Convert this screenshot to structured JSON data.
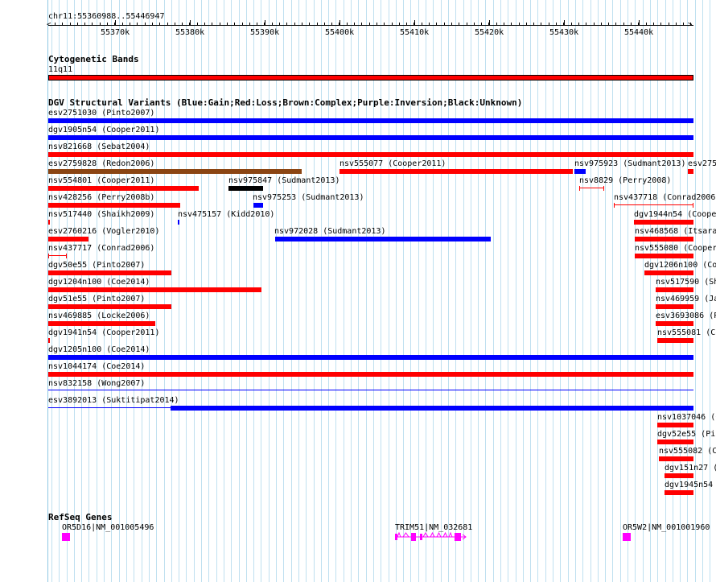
{
  "ruler": {
    "position_label": "chr11:55360988..55446947",
    "tick_labels": [
      "55370k",
      "55380k",
      "55390k",
      "55400k",
      "55410k",
      "55420k",
      "55430k",
      "55440k"
    ]
  },
  "cytoband": {
    "track_title": "Cytogenetic Bands",
    "band_label": "11q11",
    "band_color": "#ff0000"
  },
  "dgv": {
    "track_title": "DGV Structural Variants (Blue:Gain;Red:Loss;Brown:Complex;Purple:Inversion;Black:Unknown)",
    "colors": {
      "gain": "#0000ff",
      "loss": "#ff0000",
      "complex": "#8b4513",
      "inversion": "#800080",
      "unknown": "#000000"
    },
    "variants": [
      {
        "label": "esv2751030 (Pinto2007)",
        "type": "gain"
      },
      {
        "label": "dgv1905n54 (Cooper2011)",
        "type": "gain"
      },
      {
        "label": "nsv821668 (Sebat2004)",
        "type": "loss"
      },
      {
        "label": "esv2759828 (Redon2006)",
        "type": "complex"
      },
      {
        "label": "nsv555077 (Cooper2011)",
        "type": "loss"
      },
      {
        "label": "nsv975923 (Sudmant2013)",
        "type": "gain"
      },
      {
        "label": "esv275",
        "type": "loss"
      },
      {
        "label": "nsv554801 (Cooper2011)",
        "type": "loss"
      },
      {
        "label": "nsv975847 (Sudmant2013)",
        "type": "unknown"
      },
      {
        "label": "nsv8829 (Perry2008)",
        "type": "loss"
      },
      {
        "label": "nsv428256 (Perry2008b)",
        "type": "loss"
      },
      {
        "label": "nsv975253 (Sudmant2013)",
        "type": "gain"
      },
      {
        "label": "nsv437718 (Conrad2006",
        "type": "loss"
      },
      {
        "label": "nsv517440 (Shaikh2009)",
        "type": "loss"
      },
      {
        "label": "nsv475157 (Kidd2010)",
        "type": "gain"
      },
      {
        "label": "dgv1944n54 (Coope",
        "type": "loss"
      },
      {
        "label": "esv2760216 (Vogler2010)",
        "type": "loss"
      },
      {
        "label": "nsv972028 (Sudmant2013)",
        "type": "gain"
      },
      {
        "label": "nsv468568 (Itsara",
        "type": "loss"
      },
      {
        "label": "nsv437717 (Conrad2006)",
        "type": "loss"
      },
      {
        "label": "nsv555080 (Cooper",
        "type": "loss"
      },
      {
        "label": "dgv50e55 (Pinto2007)",
        "type": "loss"
      },
      {
        "label": "dgv1206n100 (Co",
        "type": "loss"
      },
      {
        "label": "dgv1204n100 (Coe2014)",
        "type": "loss"
      },
      {
        "label": "nsv517590 (Sh",
        "type": "loss"
      },
      {
        "label": "dgv51e55 (Pinto2007)",
        "type": "loss"
      },
      {
        "label": "nsv469959 (Ja",
        "type": "loss"
      },
      {
        "label": "nsv469885 (Locke2006)",
        "type": "loss"
      },
      {
        "label": "esv3693086 (P",
        "type": "loss"
      },
      {
        "label": "dgv1941n54 (Cooper2011)",
        "type": "loss"
      },
      {
        "label": "nsv555081 (Co",
        "type": "loss"
      },
      {
        "label": "dgv1205n100 (Coe2014)",
        "type": "gain"
      },
      {
        "label": "nsv1044174 (Coe2014)",
        "type": "loss"
      },
      {
        "label": "nsv832158 (Wong2007)",
        "type": "gain"
      },
      {
        "label": "esv3892013 (Suktitipat2014)",
        "type": "gain"
      },
      {
        "label": "nsv1037046 (C",
        "type": "loss"
      },
      {
        "label": "dgv52e55 (Pin",
        "type": "loss"
      },
      {
        "label": "nsv555082 (Co",
        "type": "loss"
      },
      {
        "label": "dgv151n27 (Co",
        "type": "loss"
      },
      {
        "label": "dgv1945n54",
        "type": "loss"
      }
    ]
  },
  "refseq": {
    "track_title": "RefSeq Genes",
    "gene_color": "#ff00ff",
    "genes": [
      {
        "label": "OR5D16|NM_001005496"
      },
      {
        "label": "TRIM51|NM_032681"
      },
      {
        "label": "OR5W2|NM_001001960"
      }
    ]
  }
}
